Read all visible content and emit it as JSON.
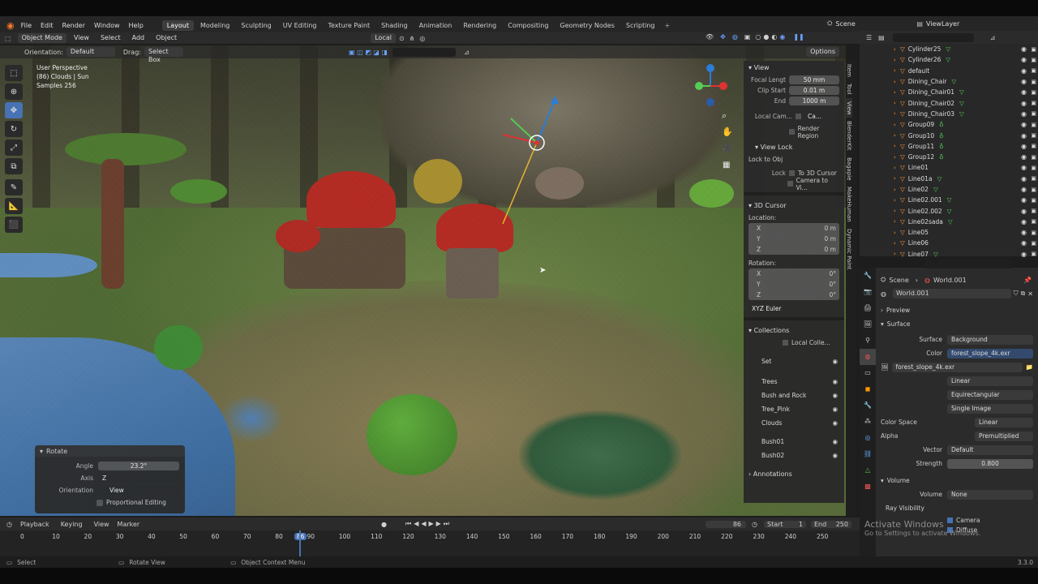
{
  "menu": {
    "items": [
      "File",
      "Edit",
      "Render",
      "Window",
      "Help"
    ]
  },
  "workspaces": {
    "tabs": [
      "Layout",
      "Modeling",
      "Sculpting",
      "UV Editing",
      "Texture Paint",
      "Shading",
      "Animation",
      "Rendering",
      "Compositing",
      "Geometry Nodes",
      "Scripting"
    ],
    "active": "Layout"
  },
  "scene": {
    "label": "Scene",
    "viewlayer": "ViewLayer"
  },
  "viewport_header": {
    "mode": "Object Mode",
    "menus": [
      "View",
      "Select",
      "Add",
      "Object"
    ],
    "transform": "Local",
    "orientation_label": "Orientation:",
    "orientation_value": "Default",
    "drag_label": "Drag:",
    "drag_value": "Select Box",
    "options": "Options"
  },
  "overlay_text": {
    "line1": "User Perspective",
    "line2": "(86) Clouds | Sun",
    "line3": "Samples 256"
  },
  "npanel": {
    "view_title": "View",
    "focal_label": "Focal Lengt",
    "focal_value": "50 mm",
    "clip_start_label": "Clip Start",
    "clip_start_value": "0.01 m",
    "end_label": "End",
    "end_value": "1000 m",
    "local_cam_label": "Local Cam...",
    "local_cam_value": "Ca...",
    "render_region": "Render Region",
    "view_lock_title": "View Lock",
    "lock_to_obj": "Lock to Obj",
    "lock_label": "Lock",
    "lock_3dcursor": "To 3D Cursor",
    "lock_camera": "Camera to Vi...",
    "cursor_title": "3D Cursor",
    "location_label": "Location:",
    "loc": [
      {
        "axis": "X",
        "value": "0 m"
      },
      {
        "axis": "Y",
        "value": "0 m"
      },
      {
        "axis": "Z",
        "value": "0 m"
      }
    ],
    "rotation_label": "Rotation:",
    "rot": [
      {
        "axis": "X",
        "value": "0°"
      },
      {
        "axis": "Y",
        "value": "0°"
      },
      {
        "axis": "Z",
        "value": "0°"
      }
    ],
    "euler": "XYZ Euler",
    "collections_title": "Collections",
    "local_coll": "Local Colle...",
    "collections": [
      "Set",
      "Trees",
      "Bush and Rock",
      "Tree_Pink",
      "Clouds",
      "Bush01",
      "Bush02"
    ],
    "annotations": "Annotations"
  },
  "sidetabs": [
    "Item",
    "Tool",
    "View",
    "BlenderKit",
    "Bagapie",
    "MakeHuman",
    "Dynamic Paint"
  ],
  "outliner": {
    "items": [
      {
        "name": "Cylinder25"
      },
      {
        "name": "Cylinder26"
      },
      {
        "name": "default"
      },
      {
        "name": "Dining_Chair"
      },
      {
        "name": "Dining_Chair01"
      },
      {
        "name": "Dining_Chair02"
      },
      {
        "name": "Dining_Chair03"
      },
      {
        "name": "Group09"
      },
      {
        "name": "Group10"
      },
      {
        "name": "Group11"
      },
      {
        "name": "Group12"
      },
      {
        "name": "Line01"
      },
      {
        "name": "Line01a"
      },
      {
        "name": "Line02"
      },
      {
        "name": "Line02.001"
      },
      {
        "name": "Line02.002"
      },
      {
        "name": "Line02sada"
      },
      {
        "name": "Line05"
      },
      {
        "name": "Line06"
      },
      {
        "name": "Line07"
      }
    ]
  },
  "properties": {
    "breadcrumb_scene": "Scene",
    "breadcrumb_world": "World.001",
    "world_name": "World.001",
    "preview": "Preview",
    "surface": "Surface",
    "surface_label": "Surface",
    "surface_value": "Background",
    "color_label": "Color",
    "color_value": "forest_slope_4k.exr",
    "image_name": "forest_slope_4k.exr",
    "interp": "Linear",
    "projection": "Equirectangular",
    "source": "Single Image",
    "colorspace_label": "Color Space",
    "colorspace_value": "Linear",
    "alpha_label": "Alpha",
    "alpha_value": "Premultiplied",
    "vector_label": "Vector",
    "vector_value": "Default",
    "strength_label": "Strength",
    "strength_value": "0.800",
    "volume": "Volume",
    "volume_label": "Volume",
    "volume_value": "None",
    "ray_visibility": "Ray Visibility",
    "camera": "Camera",
    "diffuse": "Diffuse"
  },
  "rotate_panel": {
    "title": "Rotate",
    "angle_label": "Angle",
    "angle_value": "23.2°",
    "axis_label": "Axis",
    "axis_value": "Z",
    "orient_label": "Orientation",
    "orient_value": "View",
    "proportional": "Proportional Editing"
  },
  "timeline": {
    "menus": [
      "Playback",
      "Keying",
      "View",
      "Marker"
    ],
    "current_frame": "86",
    "start_label": "Start",
    "start": "1",
    "end_label": "End",
    "end": "250",
    "ticks": [
      "0",
      "10",
      "20",
      "30",
      "40",
      "50",
      "60",
      "70",
      "80",
      "86",
      "90",
      "100",
      "110",
      "120",
      "130",
      "140",
      "150",
      "160",
      "170",
      "180",
      "190",
      "200",
      "210",
      "220",
      "230",
      "240",
      "250"
    ]
  },
  "status": {
    "select": "Select",
    "rotate_view": "Rotate View",
    "context_menu": "Object Context Menu",
    "version": "3.3.0"
  },
  "watermark": {
    "line1": "Activate Windows",
    "line2": "Go to Settings to activate Windows."
  }
}
